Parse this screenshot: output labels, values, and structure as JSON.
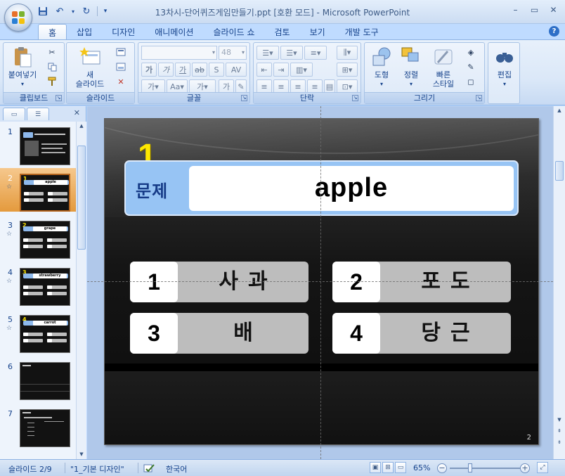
{
  "window": {
    "title": "13차시-단어퀴즈게임만들기.ppt [호환 모드] - Microsoft PowerPoint"
  },
  "ribbon_tabs": [
    "홈",
    "삽입",
    "디자인",
    "애니메이션",
    "슬라이드 쇼",
    "검토",
    "보기",
    "개발 도구"
  ],
  "ribbon": {
    "clipboard": {
      "group_label": "클립보드",
      "paste_label": "붙여넣기"
    },
    "slides": {
      "group_label": "슬라이드",
      "new_slide_label_1": "새",
      "new_slide_label_2": "슬라이드"
    },
    "font": {
      "group_label": "글꼴",
      "font_name": "",
      "font_size": "48"
    },
    "paragraph": {
      "group_label": "단락"
    },
    "drawing": {
      "group_label": "그리기",
      "shapes_label": "도형",
      "arrange_label": "정렬",
      "quick_styles_label_1": "빠른",
      "quick_styles_label_2": "스타일"
    },
    "editing": {
      "edit_label": "편집"
    }
  },
  "slide_panel": {
    "thumbnails": [
      {
        "number": "1",
        "title_text": ""
      },
      {
        "number": "2",
        "word": "apple",
        "quiz_number": "1"
      },
      {
        "number": "3",
        "word": "grape",
        "quiz_number": "2"
      },
      {
        "number": "4",
        "word": "strawberry",
        "quiz_number": "3"
      },
      {
        "number": "5",
        "word": "carrot",
        "quiz_number": "4"
      },
      {
        "number": "6"
      },
      {
        "number": "7"
      }
    ]
  },
  "slide": {
    "question_number": "1",
    "question_label": "문제",
    "word": "apple",
    "answers": [
      {
        "num": "1",
        "text": "사과"
      },
      {
        "num": "2",
        "text": "포도"
      },
      {
        "num": "3",
        "text": "배"
      },
      {
        "num": "4",
        "text": "당근"
      }
    ],
    "page_number": "2"
  },
  "statusbar": {
    "slide_info": "슬라이드 2/9",
    "theme": "\"1_기본 디자인\"",
    "language": "한국어",
    "zoom": "65%"
  },
  "colors": {
    "question_number": "#ffe800",
    "banner": "#97c4f4",
    "label": "#163b87",
    "answer_box": "#bdbdbd"
  }
}
